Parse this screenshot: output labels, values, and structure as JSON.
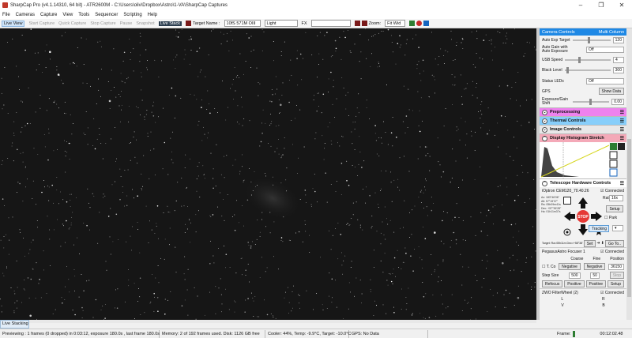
{
  "window": {
    "title": "SharpCap Pro (v4.1.14310, 64 bit) - ATR2600M - C:\\Users\\oliv\\Dropbox\\Astro\\1-VA\\SharpCap Captures",
    "controls": [
      "–",
      "❐",
      "✕"
    ]
  },
  "menu": [
    "File",
    "Cameras",
    "Capture",
    "View",
    "Tools",
    "Sequencer",
    "Scripting",
    "Help"
  ],
  "toolbar": {
    "live_view": "Live View",
    "start_capture": "Start Capture",
    "quick_capture": "Quick Capture",
    "stop_capture": "Stop Capture",
    "pause": "Pause",
    "snapshot": "Snapshot",
    "live_stack": "Live Stack",
    "target_label": "Target Name :",
    "target_value": "10fS 571M OIII",
    "light_value": "Light",
    "fx_label": "FX",
    "zoom_label": "Zoom:",
    "zoom_value": "Fit Wid"
  },
  "right_panel": {
    "camera_controls": "Camera Controls",
    "multi_column": "Multi Column",
    "auto_exp_target": {
      "label": "Auto Exp Target",
      "value": "120"
    },
    "auto_gain": {
      "label": "Auto Gain with Auto Exposure",
      "value": "Off"
    },
    "usb_speed": {
      "label": "USB Speed",
      "value": "4"
    },
    "black_level": {
      "label": "Black Level",
      "value": "300"
    },
    "status_leds": {
      "label": "Status LEDs",
      "value": "Off"
    },
    "gps": {
      "label": "GPS",
      "button": "Show Data"
    },
    "exposure_gain_shift": {
      "label": "Exposure/Gain Shift",
      "value": "0.00"
    },
    "sections": {
      "preprocessing": "Preprocessing",
      "thermal": "Thermal Controls",
      "image": "Image Controls",
      "histogram": "Display Histogram Stretch",
      "telescope": "Telescope Hardware Controls"
    },
    "mount": {
      "name": "iOptron CEM120_70.40.26",
      "connected": "Connected",
      "rate_label": "Rate:",
      "rate_value": "16x",
      "setup": "Setup",
      "park": "Park",
      "tracking": "Tracking",
      "stop": "STOP",
      "set": "Set",
      "goto": "Go To..",
      "coords": [
        "Az: 183°46'06\"",
        "Alt: 57°19'37\"",
        "Ra: 05h09m41s",
        "Dec: +57°36'28\"",
        "Ha: 01h11m37s"
      ],
      "target_text": "Target: Ra=05h11m Dec=+58°38'"
    },
    "focuser": {
      "name": "PegasusAstro Focuser 1",
      "connected": "Connected",
      "coarse": "Coarse",
      "fine": "Fine",
      "position": "Position",
      "t_comp": "T. Co",
      "neg1": "Negative",
      "neg2": "Negative",
      "pos_value": "36150",
      "step_size": "Step Size",
      "step1": "500",
      "step2": "50",
      "stop": "Stop",
      "refocus": "Refocus",
      "pos1": "Positive",
      "pos2": "Positive",
      "setup": "Setup"
    },
    "filterwheel": {
      "name": "ZWO FilterWheel (2)",
      "connected": "Connected",
      "filters": [
        "L",
        "R",
        "V",
        "B"
      ]
    }
  },
  "status": {
    "tab": "Live Stacking",
    "previewing": "Previewing : 1 frames (0 dropped) in 0:03:12, exposure 180.0s , last frame 180.0s",
    "memory": "Memory: 2 of 192 frames used. Disk: 1126 GB free",
    "cooler": "Cooler: 44%, Temp: -9.9°C, Target: -10.0°C",
    "gps": "GPS: No Data",
    "frame_label": "Frame:",
    "elapsed": "00:12:02.48"
  },
  "colors": {
    "accent": "#1e88e5",
    "preprocessing": "#ee82ee",
    "thermal": "#87cefa",
    "image": "#e8e8e8",
    "histogram": "#f4a9b8",
    "telescope": "#ffffff",
    "stop_red": "#e53935"
  }
}
